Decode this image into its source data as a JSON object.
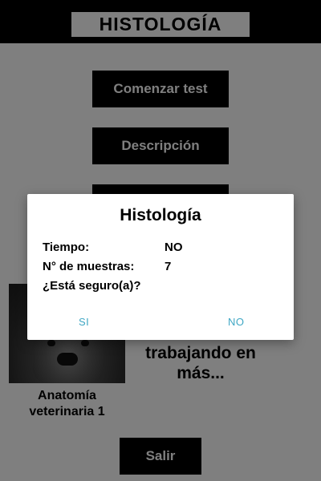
{
  "app": {
    "title": "HISTOLOGÍA",
    "buttons": {
      "start": "Comenzar test",
      "description": "Descripción",
      "exit": "Salir"
    },
    "card": {
      "label": "Anatomía veterinaria 1"
    },
    "coming_text": "trabajando en más..."
  },
  "dialog": {
    "title": "Histología",
    "time_label": "Tiempo:",
    "time_value": "NO",
    "samples_label": "N° de muestras:",
    "samples_value": "7",
    "confirm_question": "¿Está seguro(a)?",
    "yes_label": "SI",
    "no_label": "NO",
    "button_color": "#3fa7c4"
  },
  "colors": {
    "dark": "#000000",
    "scrim_opacity": "0.5"
  }
}
